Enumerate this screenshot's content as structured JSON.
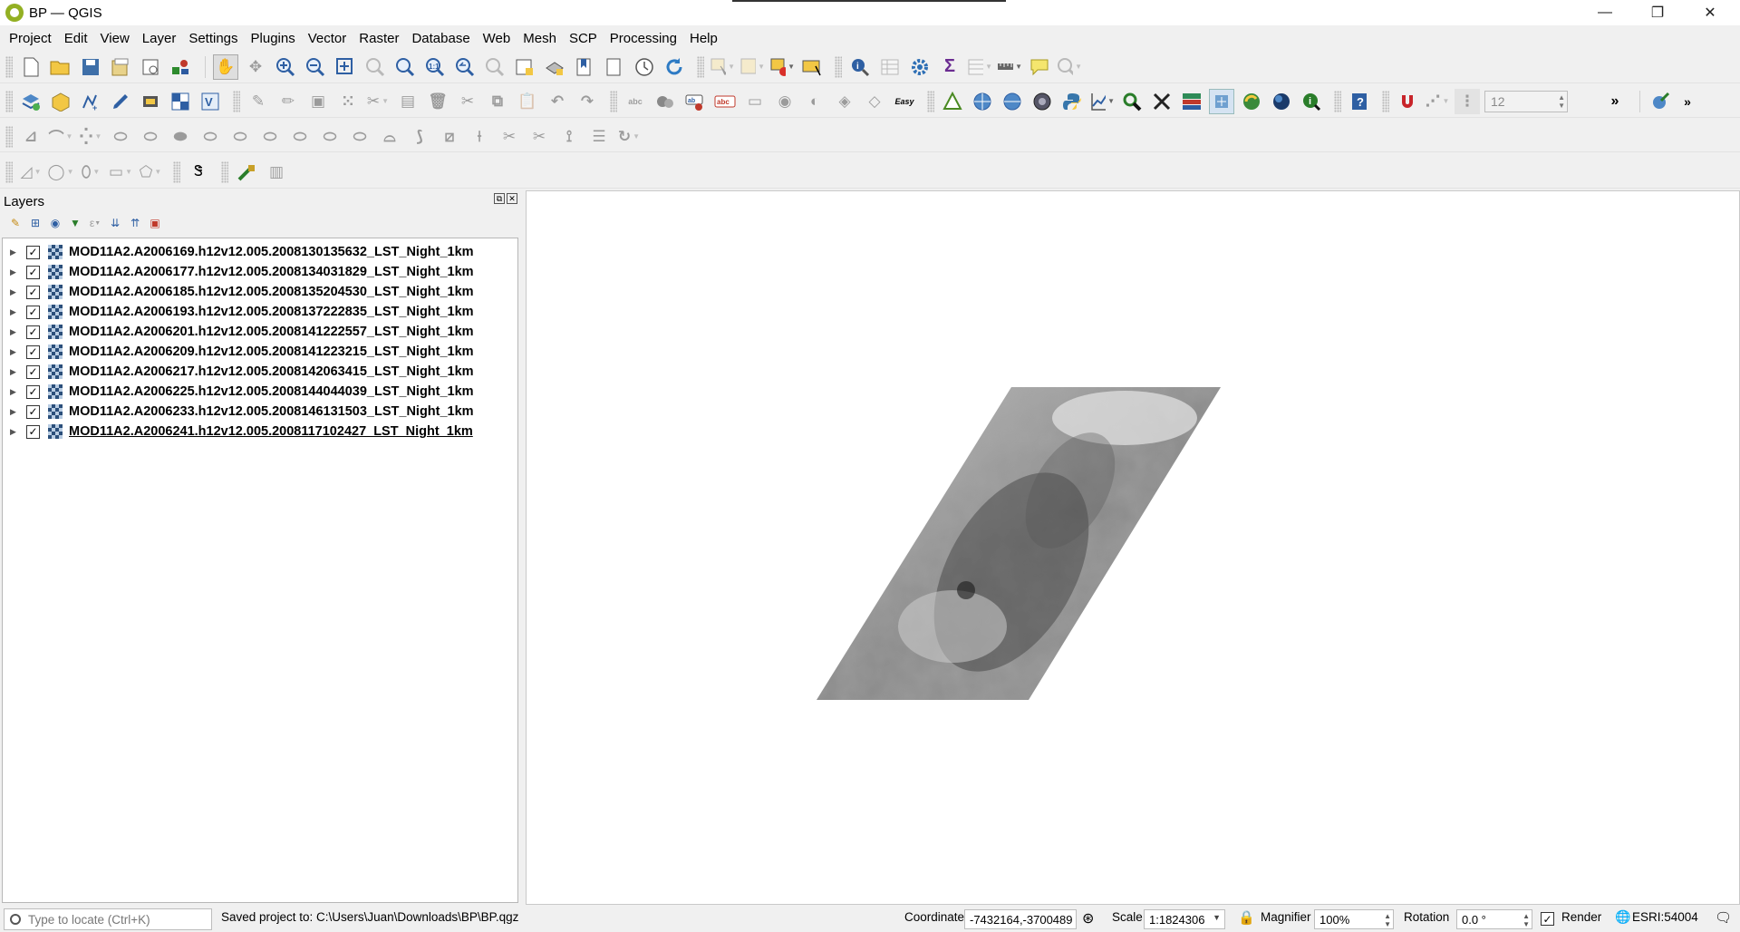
{
  "window": {
    "title": "BP — QGIS",
    "controls": {
      "minimize": "—",
      "maximize": "❐",
      "close": "✕"
    }
  },
  "menu": [
    "Project",
    "Edit",
    "View",
    "Layer",
    "Settings",
    "Plugins",
    "Vector",
    "Raster",
    "Database",
    "Web",
    "Mesh",
    "SCP",
    "Processing",
    "Help"
  ],
  "toolbar": {
    "font_size_value": "12",
    "easy_label": "Easy"
  },
  "layers_panel": {
    "title": "Layers",
    "layers": [
      {
        "name": "MOD11A2.A2006169.h12v12.005.2008130135632_LST_Night_1km",
        "checked": "✓"
      },
      {
        "name": "MOD11A2.A2006177.h12v12.005.2008134031829_LST_Night_1km",
        "checked": "✓"
      },
      {
        "name": "MOD11A2.A2006185.h12v12.005.2008135204530_LST_Night_1km",
        "checked": "✓"
      },
      {
        "name": "MOD11A2.A2006193.h12v12.005.2008137222835_LST_Night_1km",
        "checked": "✓"
      },
      {
        "name": "MOD11A2.A2006201.h12v12.005.2008141222557_LST_Night_1km",
        "checked": "✓"
      },
      {
        "name": "MOD11A2.A2006209.h12v12.005.2008141223215_LST_Night_1km",
        "checked": "✓"
      },
      {
        "name": "MOD11A2.A2006217.h12v12.005.2008142063415_LST_Night_1km",
        "checked": "✓"
      },
      {
        "name": "MOD11A2.A2006225.h12v12.005.2008144044039_LST_Night_1km",
        "checked": "✓"
      },
      {
        "name": "MOD11A2.A2006233.h12v12.005.2008146131503_LST_Night_1km",
        "checked": "✓"
      },
      {
        "name": "MOD11A2.A2006241.h12v12.005.2008117102427_LST_Night_1km",
        "checked": "✓"
      }
    ]
  },
  "status": {
    "locate_placeholder": "Type to locate (Ctrl+K)",
    "message": "Saved project to: C:\\Users\\Juan\\Downloads\\BP\\BP.qgz",
    "coordinate_label": "Coordinate",
    "coordinate_value": "-7432164,-3700489",
    "scale_label": "Scale",
    "scale_value": "1:1824306",
    "magnifier_label": "Magnifier",
    "magnifier_value": "100%",
    "rotation_label": "Rotation",
    "rotation_value": "0.0 °",
    "render_label": "Render",
    "render_checked": "✓",
    "crs_label": "ESRI:54004"
  }
}
